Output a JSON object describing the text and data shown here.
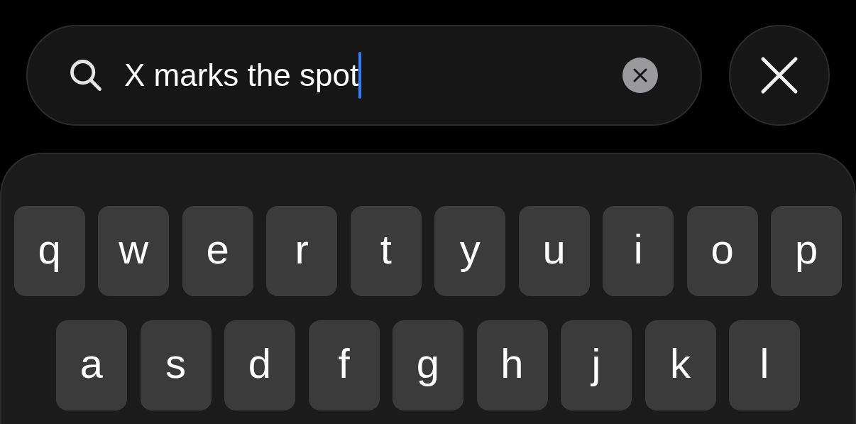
{
  "search": {
    "value": "X marks the spot",
    "focused": true
  },
  "keyboard": {
    "rows": [
      [
        "q",
        "w",
        "e",
        "r",
        "t",
        "y",
        "u",
        "i",
        "o",
        "p"
      ],
      [
        "a",
        "s",
        "d",
        "f",
        "g",
        "h",
        "j",
        "k",
        "l"
      ]
    ]
  }
}
